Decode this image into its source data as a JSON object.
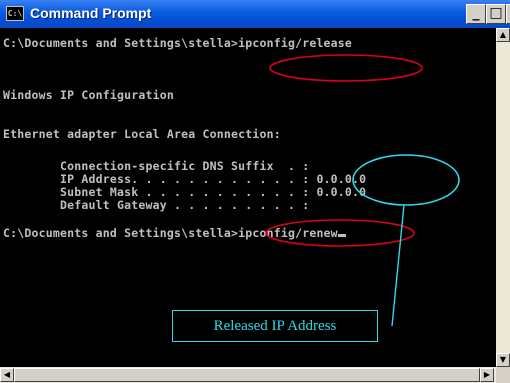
{
  "window": {
    "title": "Command Prompt",
    "icon_text": "C:\\",
    "minimize_label": "_",
    "maximize_label": "□",
    "close_label": "x"
  },
  "console": {
    "lines": [
      "C:\\Documents and Settings\\stella>ipconfig/release",
      "",
      "Windows IP Configuration",
      "",
      "",
      "Ethernet adapter Local Area Connection:",
      "",
      "        Connection-specific DNS Suffix  . :",
      "        IP Address. . . . . . . . . . . . : 0.0.0.0",
      "        Subnet Mask . . . . . . . . . . . : 0.0.0.0",
      "        Default Gateway . . . . . . . . . :",
      "",
      "C:\\Documents and Settings\\stella>ipconfig/renew"
    ]
  },
  "annotation": {
    "label": "Released IP Address",
    "ellipse_color": "#d9001b",
    "callout_color": "#30d8e8"
  },
  "scrollbar": {
    "up_arrow": "▲",
    "down_arrow": "▼",
    "left_arrow": "◀",
    "right_arrow": "▶"
  }
}
